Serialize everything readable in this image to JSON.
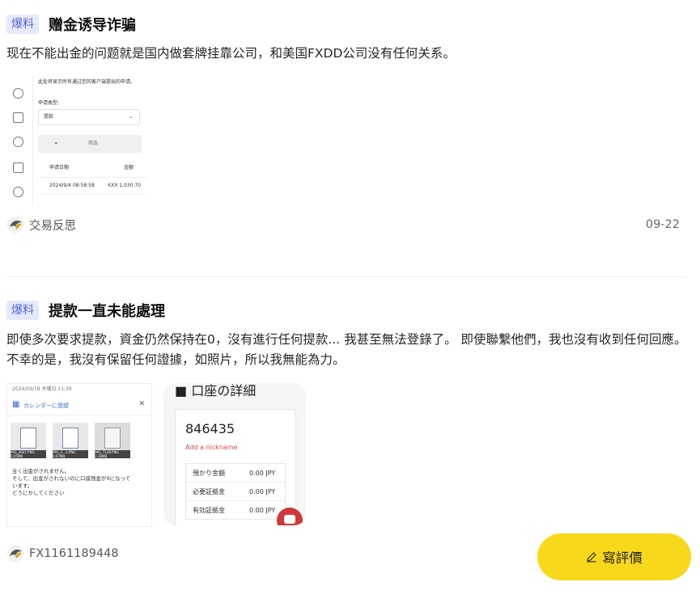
{
  "posts": [
    {
      "tag": "爆料",
      "title": "赠金诱导诈骗",
      "body": "现在不能出金的问题就是国内做套牌挂靠公司，和美国FXDD公司没有任何关系。",
      "author": "交易反思",
      "date": "09-22",
      "screenshot": {
        "header": "此处将显示所有通过您的客户端提出的申请。",
        "type_label": "申请类型:",
        "select_value": "提款",
        "filter_label": "筛选",
        "col_date": "申请日期",
        "col_amount": "金额",
        "row_date": "2024/9/4 08:58:58",
        "row_amount": "XXX 1,030.70"
      }
    },
    {
      "tag": "爆料",
      "title": "提款一直未能處理",
      "body": "即使多次要求提款，資金仍然保持在0，沒有進行任何提款... 我甚至無法登錄了。 即使聯繫他們，我也沒有收到任何回應。 不幸的是，我沒有保留任何證據，如照片，所以我無能為力。",
      "author": "FX1161189448",
      "screenshot_a": {
        "timestamp": "2024/09/18 木曜日 21:39",
        "calendar_label": "カレンダーに登録",
        "files": [
          "IMG_2647.PNG 0.05MB",
          "IMG_2...5.PNG 0.07MB",
          "IMG_7128.PNG 2.18MB"
        ],
        "message_lines": [
          "全く出金がされません。",
          "そして、出金がされないのに口座残金が0になって",
          "います。",
          "どうにかしてください"
        ]
      },
      "screenshot_b": {
        "heading": "口座の詳細",
        "account": "846435",
        "nickname_link": "Add a nickname",
        "rows": [
          {
            "k": "預かり金額",
            "v": "0.00 JPY"
          },
          {
            "k": "必要証拠金",
            "v": "0.00 JPY"
          },
          {
            "k": "有効証拠金",
            "v": "0.00 JPY"
          }
        ]
      }
    }
  ],
  "review_button": "寫評價",
  "colors": {
    "tag_bg": "#e6e9fb",
    "tag_fg": "#5866d3",
    "button_bg": "#f8d81a"
  }
}
